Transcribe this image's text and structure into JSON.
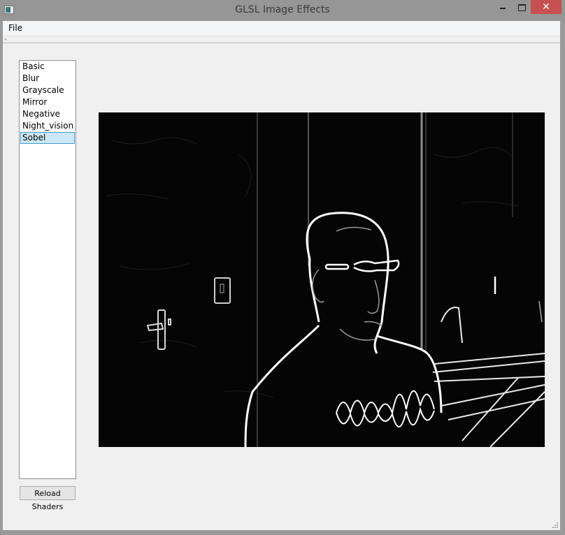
{
  "window": {
    "title": "GLSL Image Effects",
    "controls": {
      "minimize": "minimize-icon",
      "maximize": "maximize-icon",
      "close": "✕"
    }
  },
  "menubar": {
    "file": "File"
  },
  "shader_list": {
    "items": [
      "Basic",
      "Blur",
      "Grayscale",
      "Mirror",
      "Negative",
      "Night_vision",
      "Sobel"
    ],
    "selected": "Sobel"
  },
  "reload_button": "Reload Shaders",
  "image_view": {
    "description": "Sobel edge-detection output of webcam image: man with glasses in dark room, door with handle, light switch, keyboard on right",
    "background": "#050505",
    "edge_color": "#ffffff"
  }
}
